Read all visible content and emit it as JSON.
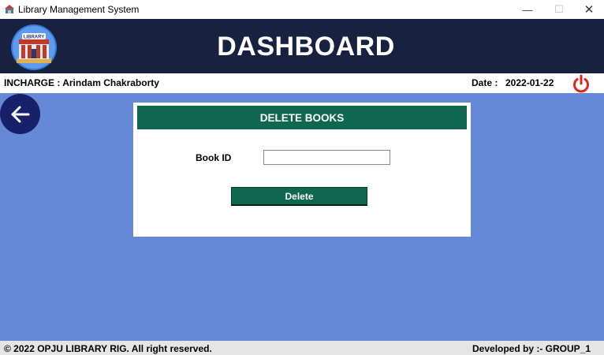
{
  "window": {
    "title": "Library Management System",
    "icons": {
      "app": "library-app-icon",
      "minimize": "minimize-icon",
      "maximize": "maximize-icon",
      "close": "close-icon"
    },
    "minimize_glyph": "—",
    "maximize_glyph": "☐",
    "close_glyph": "✕"
  },
  "header": {
    "logo_text": "LIBRARY",
    "title": "DASHBOARD",
    "background": "#172140"
  },
  "infobar": {
    "incharge": "INCHARGE : Arindam Chakraborty",
    "date_label": "Date :",
    "date_value": "2022-01-22",
    "power_icon": "power-icon",
    "power_color": "#e0261b"
  },
  "nav": {
    "back_icon": "arrow-left-icon"
  },
  "panel": {
    "title": "DELETE BOOKS",
    "book_id_label": "Book ID",
    "book_id_value": "",
    "book_id_placeholder": "",
    "delete_label": "Delete",
    "accent": "#10674f"
  },
  "footer": {
    "copyright": "© 2022 OPJU LIBRARY RIG.  All right reserved.",
    "developer": "Developed by :- GROUP_1"
  },
  "colors": {
    "background": "#6589d6",
    "back_button": "#16216a"
  }
}
